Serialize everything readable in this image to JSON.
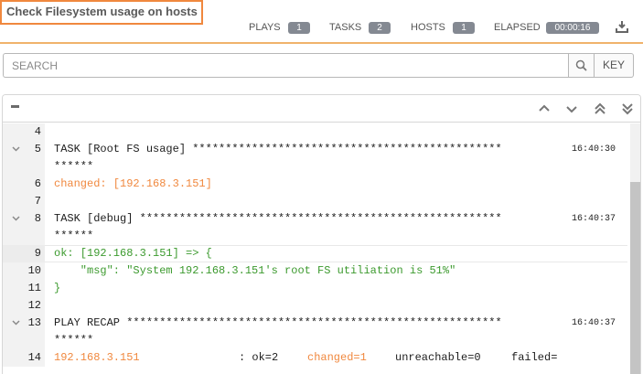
{
  "header": {
    "title": "Check Filesystem usage on hosts",
    "stats": [
      {
        "label": "PLAYS",
        "value": "1"
      },
      {
        "label": "TASKS",
        "value": "2"
      },
      {
        "label": "HOSTS",
        "value": "1"
      },
      {
        "label": "ELAPSED",
        "value": "00:00:16"
      }
    ],
    "download_icon": "download-icon"
  },
  "search": {
    "placeholder": "SEARCH",
    "value": "",
    "key_label": "KEY",
    "search_icon": "search-icon"
  },
  "toolbar": {
    "icons": [
      "collapse-all-icon",
      "chevron-up-icon",
      "chevron-down-icon",
      "double-chevron-up-icon",
      "double-chevron-down-icon"
    ]
  },
  "output": {
    "lines": [
      {
        "num": "4",
        "text": "",
        "ts": ""
      },
      {
        "num": "5",
        "text": "TASK [Root FS usage] ***********************************************",
        "ts": "16:40:30"
      },
      {
        "num": "",
        "text": "******",
        "ts": ""
      },
      {
        "num": "6",
        "text": "changed: [192.168.3.151]",
        "ts": ""
      },
      {
        "num": "7",
        "text": "",
        "ts": ""
      },
      {
        "num": "8",
        "text": "TASK [debug] *******************************************************",
        "ts": "16:40:37"
      },
      {
        "num": "",
        "text": "******",
        "ts": ""
      },
      {
        "num": "9",
        "text": "ok: [192.168.3.151] => {",
        "ts": ""
      },
      {
        "num": "10",
        "text": "    \"msg\": \"System 192.168.3.151's root FS utiliation is 51%\"",
        "ts": ""
      },
      {
        "num": "11",
        "text": "}",
        "ts": ""
      },
      {
        "num": "12",
        "text": "",
        "ts": ""
      },
      {
        "num": "13",
        "text": "PLAY RECAP *********************************************************",
        "ts": "16:40:37"
      },
      {
        "num": "",
        "text": "******",
        "ts": ""
      }
    ],
    "recap": {
      "num": "14",
      "host": "192.168.3.151",
      "ok": ": ok=2",
      "changed": "changed=1",
      "unreachable": "unreachable=0",
      "failed": "failed="
    }
  }
}
